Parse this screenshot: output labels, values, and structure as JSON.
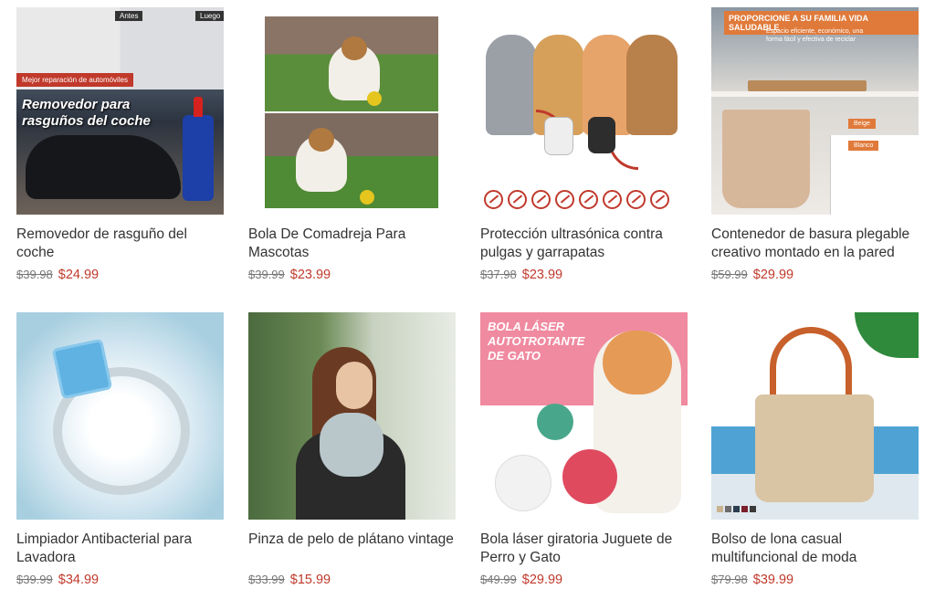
{
  "products": [
    {
      "title": "Removedor de rasguño del coche",
      "old_price": "$39.98",
      "price": "$24.99",
      "image_texts": {
        "before": "Antes",
        "after": "Luego",
        "tag": "Mejor reparación de automóviles",
        "headline": "Removedor para rasguños del coche"
      }
    },
    {
      "title": "Bola De Comadreja Para Mascotas",
      "old_price": "$39.99",
      "price": "$23.99"
    },
    {
      "title": "Protección ultrasónica contra pulgas y garrapatas",
      "old_price": "$37.98",
      "price": "$23.99"
    },
    {
      "title": "Contenedor de basura plegable creativo montado en la pared",
      "old_price": "$59.99",
      "price": "$29.99",
      "image_texts": {
        "banner": "PROPORCIONE A SU FAMILIA VIDA SALUDABLE",
        "sub": "Espacio eficiente, económico, una forma fácil y efectiva de reciclar",
        "beige": "Beige",
        "white": "Blanco"
      }
    },
    {
      "title": "Limpiador Antibacterial para Lavadora",
      "old_price": "$39.99",
      "price": "$34.99"
    },
    {
      "title": "Pinza de pelo de plátano vintage",
      "old_price": "$33.99",
      "price": "$15.99"
    },
    {
      "title": "Bola láser giratoria Juguete de Perro y Gato",
      "old_price": "$49.99",
      "price": "$29.99",
      "image_texts": {
        "headline": "BOLA LÁSER AUTOTROTANTE DE GATO"
      }
    },
    {
      "title": "Bolso de lona casual multifuncional de moda",
      "old_price": "$79.98",
      "price": "$39.99"
    }
  ],
  "colors": {
    "price": "#c0392b",
    "old_price": "#777777",
    "title": "#333333"
  }
}
